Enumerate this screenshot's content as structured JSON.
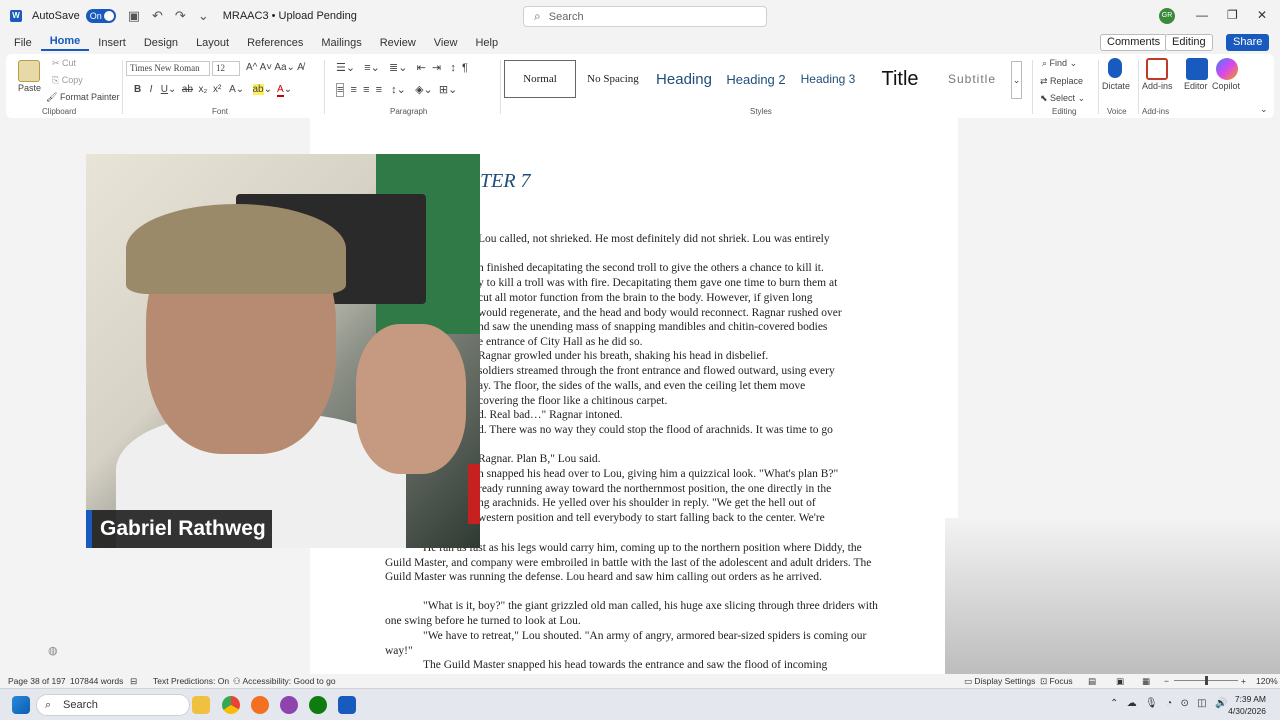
{
  "titlebar": {
    "autosave_label": "AutoSave",
    "autosave_state": "On",
    "doc_title": "MRAAC3 • Upload Pending",
    "search_placeholder": "Search",
    "avatar_initials": "GR"
  },
  "menu": {
    "tabs": [
      "File",
      "Home",
      "Insert",
      "Design",
      "Layout",
      "References",
      "Mailings",
      "Review",
      "View",
      "Help"
    ],
    "active_tab": "Home",
    "comments": "Comments",
    "editing": "Editing",
    "share": "Share"
  },
  "ribbon": {
    "clipboard": {
      "paste": "Paste",
      "cut": "Cut",
      "copy": "Copy",
      "format_painter": "Format Painter",
      "label": "Clipboard"
    },
    "font": {
      "name": "Times New Roman",
      "size": "12",
      "label": "Font"
    },
    "paragraph": {
      "label": "Paragraph"
    },
    "styles": {
      "items": [
        "Normal",
        "No Spacing",
        "Heading",
        "Heading 2",
        "Heading 3",
        "Title",
        "Subtitle"
      ],
      "label": "Styles"
    },
    "editing": {
      "find": "Find",
      "replace": "Replace",
      "select": "Select",
      "label": "Editing"
    },
    "voice": {
      "dictate": "Dictate",
      "label": "Voice"
    },
    "addins": {
      "addins": "Add-ins",
      "editor": "Editor",
      "copilot": "Copilot",
      "label": "Add-ins"
    }
  },
  "document": {
    "chapter_heading": "TER 7",
    "lines": [
      "Lou called, not shrieked. He most definitely did not shriek. Lou was entirely",
      "n finished decapitating the second troll to give the others a chance to kill it.",
      "y to kill a troll was with fire. Decapitating them gave one time to burn them at",
      "cut all motor function from the brain to the body. However, if given long",
      "would regenerate, and the head and body would reconnect. Ragnar rushed over",
      "nd saw the unending mass of snapping mandibles and chitin-covered bodies",
      "e entrance of City Hall as he did so.",
      " Ragnar growled under his breath, shaking his head in disbelief.",
      "soldiers streamed through the front entrance and flowed outward, using every",
      "ay. The floor, the sides of the walls, and even the ceiling let them move",
      " covering the floor like a chitinous carpet.",
      "d. Real bad…\" Ragnar intoned.",
      "d. There was no way they could stop the flood of arachnids. It was time to go",
      "Ragnar. Plan B,\" Lou said.",
      "n snapped his head over to Lou, giving him a quizzical look. \"What's plan B?\"",
      "ready running away toward the northernmost position, the one directly in the",
      "ng arachnids. He yelled over his shoulder in reply. \"We get the hell out of",
      "western position and tell everybody to start falling back to the center. We're"
    ],
    "full_paragraphs": [
      "He ran as fast as his legs would carry him, coming up to the northern position where Diddy, the Guild Master, and company were embroiled in battle with the last of the adolescent and adult driders. The Guild Master was running the defense. Lou heard and saw him calling out orders as he arrived.",
      "\"What is it, boy?\" the giant grizzled old man called, his huge axe slicing through three driders with one swing before he turned to look at Lou.",
      "\"We have to retreat,\" Lou shouted. \"An army of angry, armored bear-sized spiders is coming our way!\"",
      "The Guild Master snapped his head towards the entrance and saw the flood of incoming"
    ]
  },
  "webcam": {
    "name": "Gabriel Rathweg"
  },
  "statusbar": {
    "page": "Page 38 of 197",
    "words": "107844 words",
    "predictions": "Text Predictions: On",
    "accessibility": "Accessibility: Good to go",
    "display_settings": "Display Settings",
    "focus": "Focus",
    "zoom": "120%"
  },
  "taskbar": {
    "search": "Search",
    "time": "7:39 AM",
    "date": "4/30/2026"
  }
}
